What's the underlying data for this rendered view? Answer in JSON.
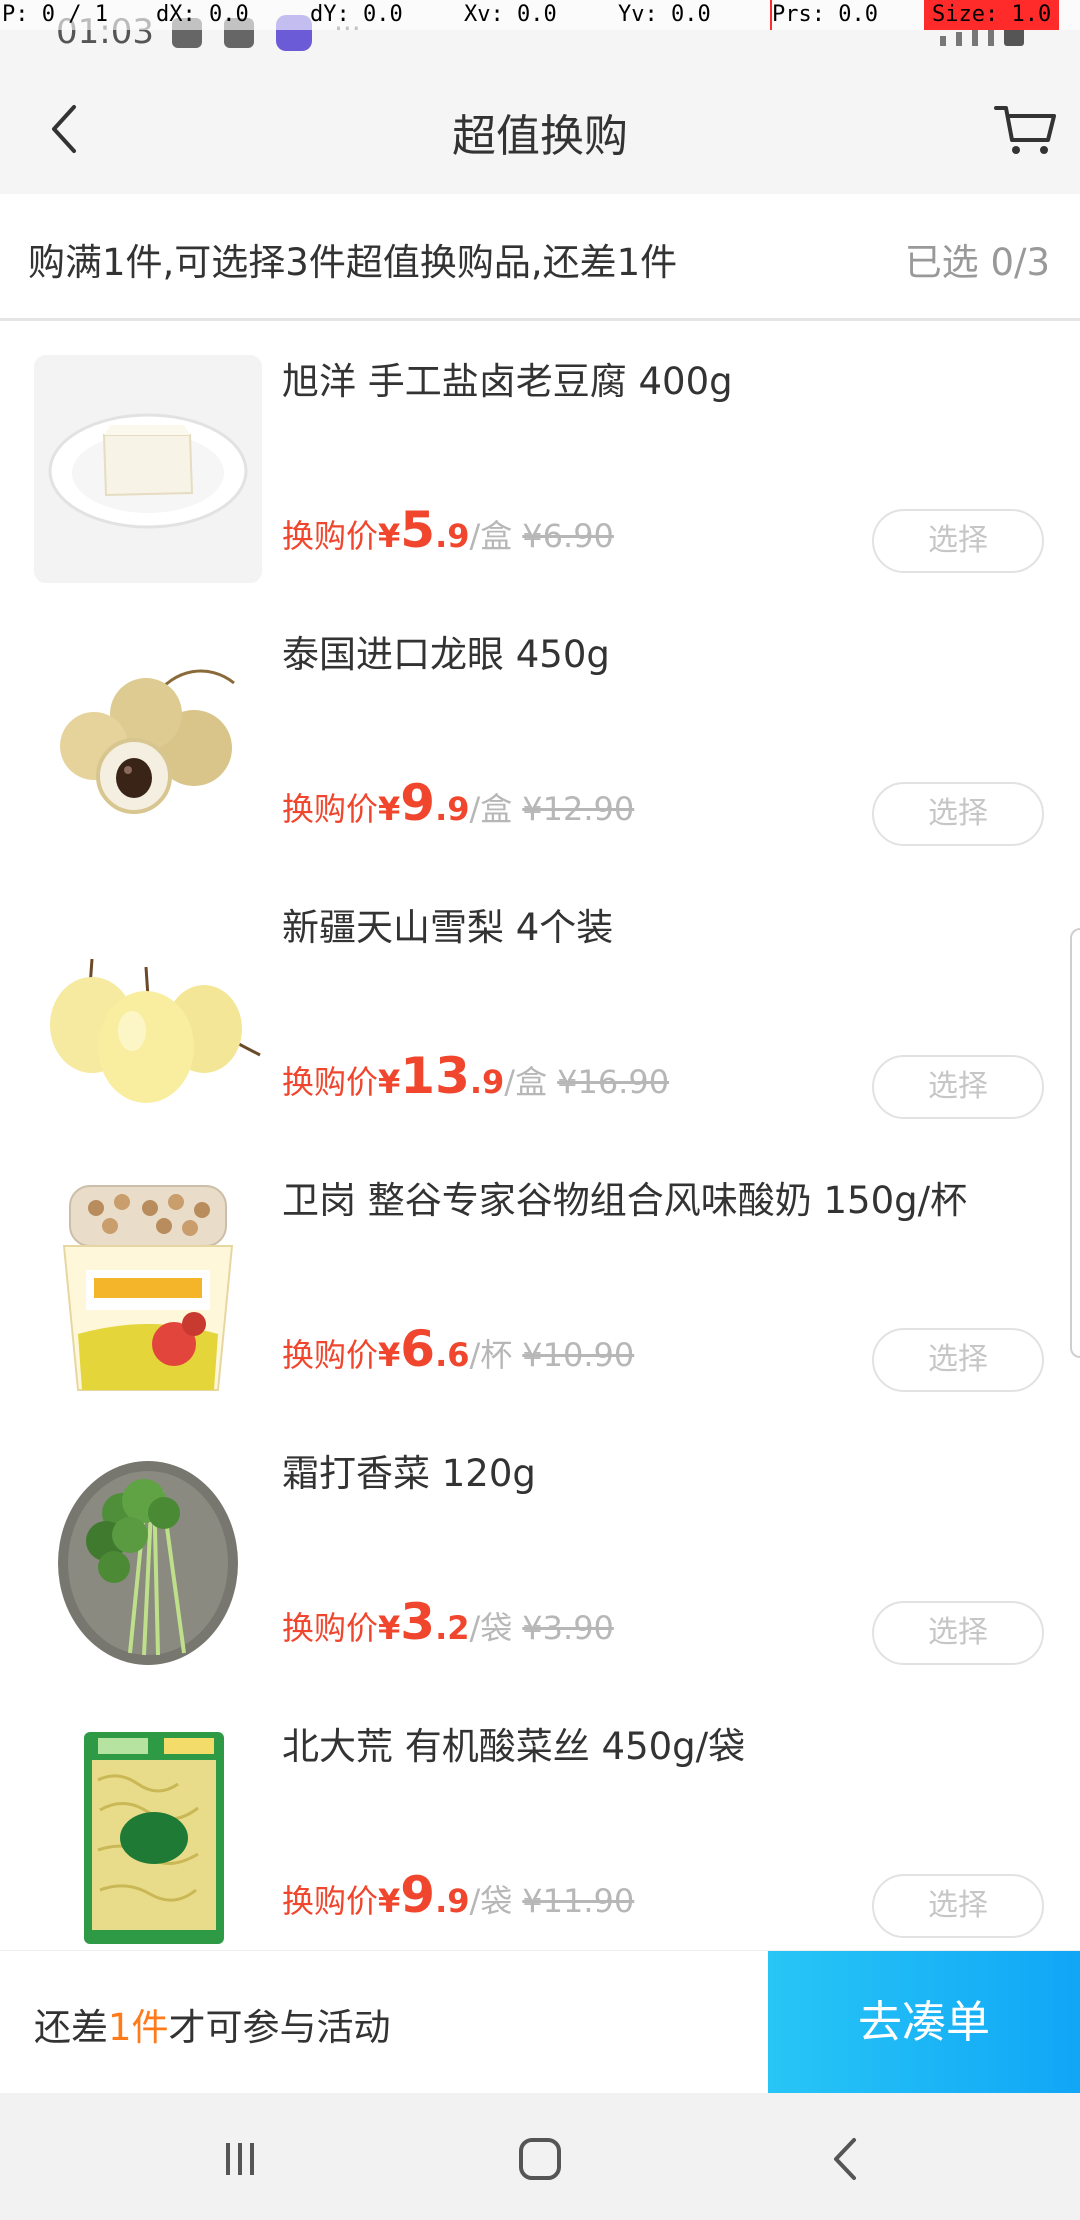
{
  "debug": {
    "p": "P: 0 / 1",
    "dx": "dX: 0.0",
    "dy": "dY: 0.0",
    "xv": "Xv: 0.0",
    "yv": "Yv: 0.0",
    "prs": "Prs: 0.0",
    "size": "Size: 1.0"
  },
  "status": {
    "time": "01:03"
  },
  "header": {
    "title": "超值换购"
  },
  "notice": {
    "message": "购满1件,可选择3件超值换购品,还差1件",
    "selected": "已选 0/3"
  },
  "price_label": "换购价",
  "currency": "¥",
  "select_label": "选择",
  "items": [
    {
      "name": "旭洋 手工盐卤老豆腐 400g",
      "price_int": "5",
      "price_dec": ".9",
      "unit": "/盒",
      "original": "¥6.90"
    },
    {
      "name": "泰国进口龙眼 450g",
      "price_int": "9",
      "price_dec": ".9",
      "unit": "/盒",
      "original": "¥12.90"
    },
    {
      "name": "新疆天山雪梨 4个装",
      "price_int": "13",
      "price_dec": ".9",
      "unit": "/盒",
      "original": "¥16.90"
    },
    {
      "name": "卫岗 整谷专家谷物组合风味酸奶 150g/杯",
      "price_int": "6",
      "price_dec": ".6",
      "unit": "/杯",
      "original": "¥10.90"
    },
    {
      "name": "霜打香菜 120g",
      "price_int": "3",
      "price_dec": ".2",
      "unit": "/袋",
      "original": "¥3.90"
    },
    {
      "name": "北大荒 有机酸菜丝 450g/袋",
      "price_int": "9",
      "price_dec": ".9",
      "unit": "/袋",
      "original": "¥11.90"
    }
  ],
  "bottom": {
    "tip_prefix": "还差",
    "tip_highlight": "1件",
    "tip_suffix": "才可参与活动",
    "go_label": "去凑单"
  },
  "colors": {
    "accent": "#f0462d",
    "button": "#11a6f6",
    "highlight": "#ff7a1a"
  }
}
